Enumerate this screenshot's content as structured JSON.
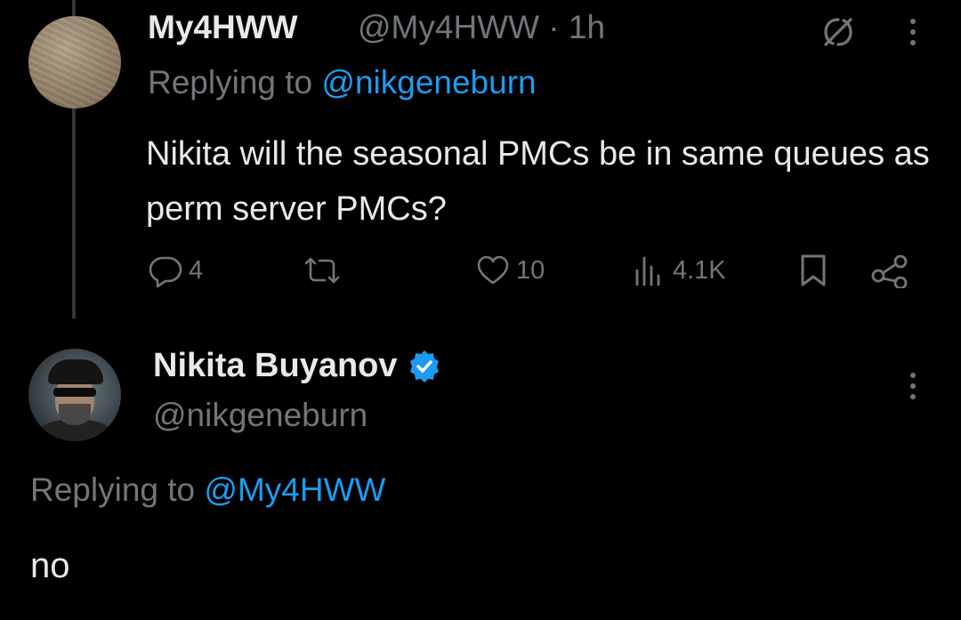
{
  "tweet": {
    "author_name": "My4HWW",
    "author_handle": "@My4HWW · 1h",
    "replying_prefix": "Replying to ",
    "replying_to": "@nikgeneburn",
    "text": "Nikita will the seasonal PMCs be in same queues as perm server PMCs?",
    "actions": {
      "replies": "4",
      "retweets": "",
      "likes": "10",
      "views": "4.1K"
    },
    "icons": [
      "grok-icon",
      "more-icon",
      "reply-icon",
      "retweet-icon",
      "heart-icon",
      "views-icon",
      "bookmark-icon",
      "share-icon"
    ]
  },
  "reply": {
    "author_name": "Nikita Buyanov",
    "author_handle": "@nikgeneburn",
    "replying_prefix": "Replying to ",
    "replying_to": "@My4HWW",
    "text": "no",
    "verified_color": "#1d9bf0"
  },
  "colors": {
    "background": "#000000",
    "text": "#e7e9ea",
    "muted": "#71767b",
    "accent": "#1d9bf0"
  }
}
